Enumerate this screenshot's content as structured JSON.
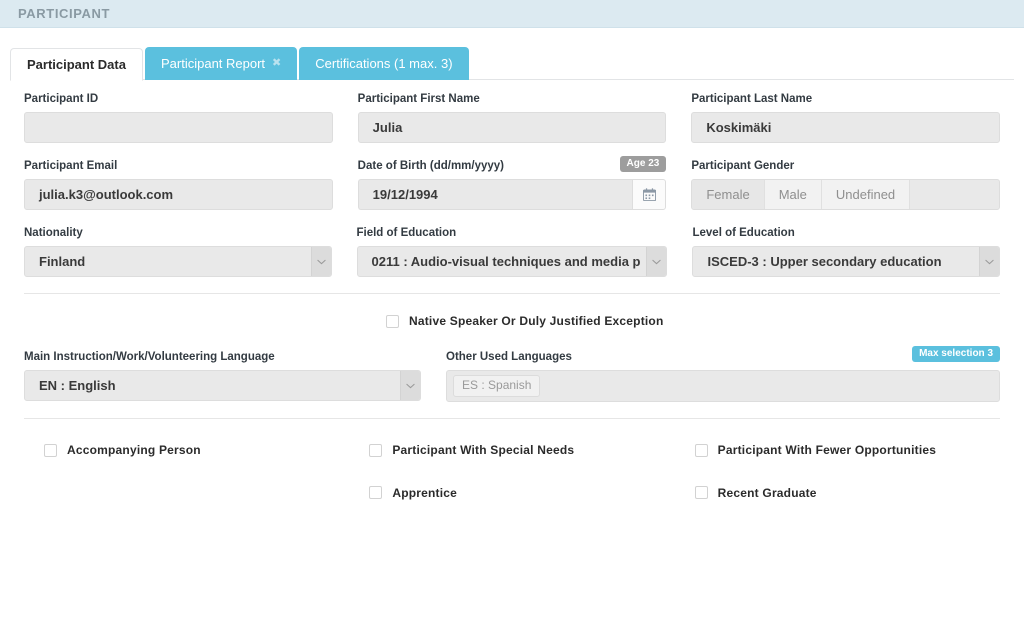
{
  "header": {
    "title": "PARTICIPANT"
  },
  "tabs": [
    {
      "label": "Participant Data",
      "active": true,
      "closable": false
    },
    {
      "label": "Participant Report",
      "active": false,
      "closable": true,
      "close_icon": "close-icon"
    },
    {
      "label": "Certifications (1 max. 3)",
      "active": false,
      "closable": false
    }
  ],
  "fields": {
    "participant_id": {
      "label": "Participant ID",
      "value": "",
      "placeholder": ""
    },
    "first_name": {
      "label": "Participant First Name",
      "value": "Julia"
    },
    "last_name": {
      "label": "Participant Last Name",
      "value": "Koskimäki"
    },
    "email": {
      "label": "Participant Email",
      "value": "julia.k3@outlook.com"
    },
    "dob": {
      "label": "Date of Birth (dd/mm/yyyy)",
      "value": "19/12/1994",
      "age_badge": "Age 23",
      "calendar_icon": "calendar-icon"
    },
    "gender": {
      "label": "Participant Gender",
      "options": [
        "Female",
        "Male",
        "Undefined"
      ],
      "selected": "Female"
    },
    "nationality": {
      "label": "Nationality",
      "value": "Finland"
    },
    "field_of_education": {
      "label": "Field of Education",
      "value": "0211 : Audio-visual techniques and media p"
    },
    "level_of_education": {
      "label": "Level of Education",
      "value": "ISCED-3 : Upper secondary education"
    },
    "main_language": {
      "label": "Main Instruction/Work/Volunteering Language",
      "value": "EN : English"
    },
    "other_languages": {
      "label": "Other Used Languages",
      "chips": [
        "ES : Spanish"
      ],
      "max_badge": "Max selection 3"
    }
  },
  "checkboxes": {
    "native_speaker": {
      "label": "Native Speaker Or Duly Justified Exception",
      "checked": false
    },
    "accompanying_person": {
      "label": "Accompanying Person",
      "checked": false
    },
    "special_needs": {
      "label": "Participant With Special Needs",
      "checked": false
    },
    "fewer_opportunities": {
      "label": "Participant With Fewer Opportunities",
      "checked": false
    },
    "apprentice": {
      "label": "Apprentice",
      "checked": false
    },
    "recent_graduate": {
      "label": "Recent Graduate",
      "checked": false
    }
  },
  "colors": {
    "header_bg": "#dceaf1",
    "tab_active_bg": "#ffffff",
    "tab_inactive_bg": "#5bc0de",
    "badge_info": "#5bc0de",
    "badge_muted": "#9d9d9d",
    "input_bg": "#e9e9e9"
  }
}
